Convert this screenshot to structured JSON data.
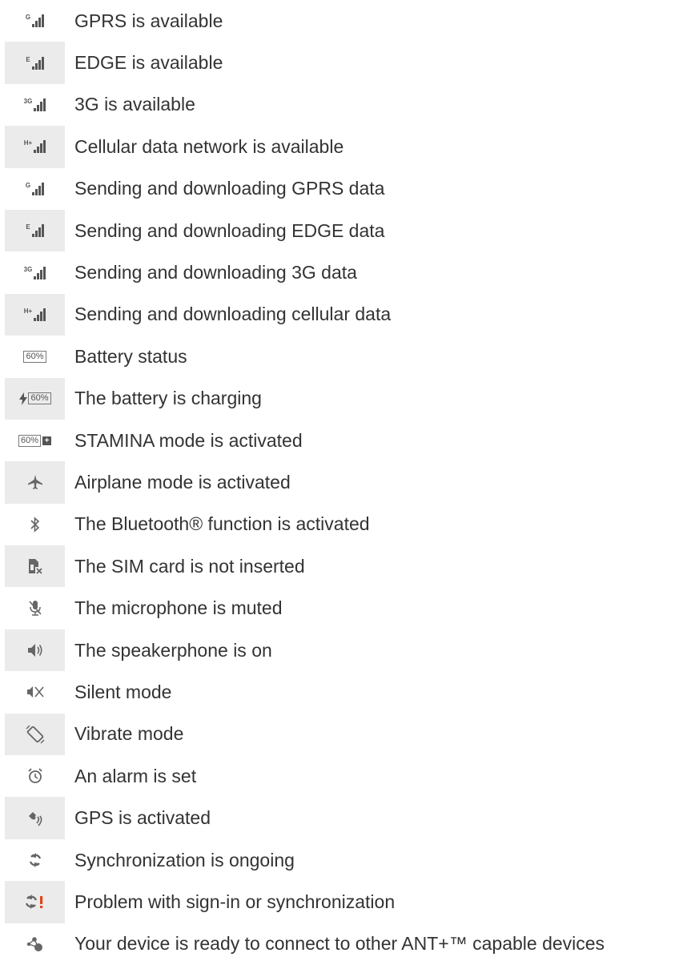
{
  "rows": [
    {
      "icon": "gprs-icon",
      "label": "GPRS is available"
    },
    {
      "icon": "edge-icon",
      "label": "EDGE is available"
    },
    {
      "icon": "3g-icon",
      "label": "3G is available"
    },
    {
      "icon": "cellular-data-icon",
      "label": "Cellular data network is available"
    },
    {
      "icon": "gprs-transfer-icon",
      "label": "Sending and downloading GPRS data"
    },
    {
      "icon": "edge-transfer-icon",
      "label": "Sending and downloading EDGE data"
    },
    {
      "icon": "3g-transfer-icon",
      "label": "Sending and downloading 3G data"
    },
    {
      "icon": "cellular-transfer-icon",
      "label": "Sending and downloading cellular data"
    },
    {
      "icon": "battery-icon",
      "label": "Battery status"
    },
    {
      "icon": "battery-charging-icon",
      "label": "The battery is charging"
    },
    {
      "icon": "stamina-icon",
      "label": "STAMINA mode is activated"
    },
    {
      "icon": "airplane-icon",
      "label": "Airplane mode is activated"
    },
    {
      "icon": "bluetooth-icon",
      "label": "The Bluetooth® function is activated"
    },
    {
      "icon": "no-sim-icon",
      "label": "The SIM card is not inserted"
    },
    {
      "icon": "mic-muted-icon",
      "label": "The microphone is muted"
    },
    {
      "icon": "speakerphone-icon",
      "label": "The speakerphone is on"
    },
    {
      "icon": "silent-icon",
      "label": "Silent mode"
    },
    {
      "icon": "vibrate-icon",
      "label": "Vibrate mode"
    },
    {
      "icon": "alarm-icon",
      "label": "An alarm is set"
    },
    {
      "icon": "gps-icon",
      "label": "GPS is activated"
    },
    {
      "icon": "sync-icon",
      "label": "Synchronization is ongoing"
    },
    {
      "icon": "sync-error-icon",
      "label": "Problem with sign-in or synchronization"
    },
    {
      "icon": "ant-icon",
      "label": "Your device is ready to connect to other ANT+™ capable devices"
    }
  ],
  "icon_text": {
    "gprs": "G",
    "edge": "E",
    "threeg": "3G",
    "cellular": "H+",
    "battery": "60%",
    "plus": "+"
  }
}
